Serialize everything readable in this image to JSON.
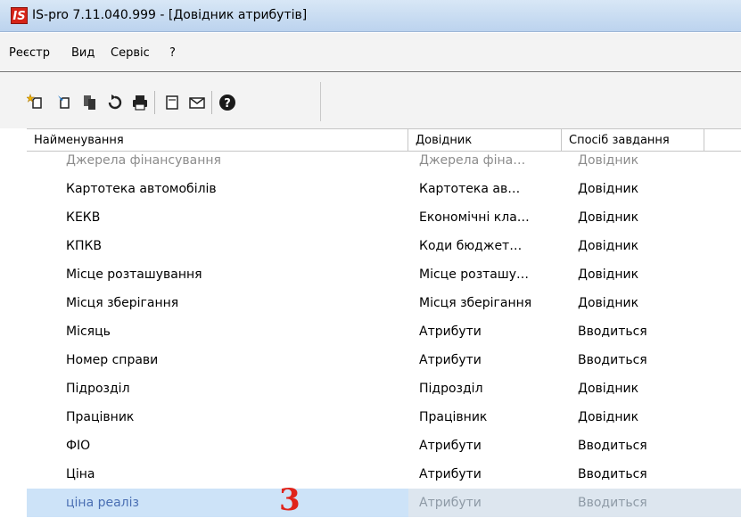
{
  "window": {
    "logo_text": "IS",
    "title": "IS-pro 7.11.040.999 - [Довідник атрибутів]"
  },
  "menu": {
    "items": [
      "Реєстр",
      "Вид",
      "Сервіс",
      "?"
    ]
  },
  "toolbar": {
    "buttons": [
      "new-doc-icon",
      "edit-doc-icon",
      "copy-doc-icon",
      "refresh-icon",
      "print-icon",
      "form-icon",
      "mail-icon",
      "help-icon"
    ]
  },
  "table": {
    "columns": [
      "Найменування",
      "Довідник",
      "Спосіб завдання"
    ],
    "rows": [
      [
        "Джерела фінансування",
        "Джерела фіна…",
        "Довідник"
      ],
      [
        "Картотека автомобілів",
        "Картотека ав…",
        "Довідник"
      ],
      [
        "КЕКВ",
        "Економічні кла…",
        "Довідник"
      ],
      [
        "КПКВ",
        "Коди бюджет…",
        "Довідник"
      ],
      [
        "Місце розташування",
        "Місце розташу…",
        "Довідник"
      ],
      [
        "Місця зберігання",
        "Місця зберігання",
        "Довідник"
      ],
      [
        "Місяць",
        "Атрибути",
        "Вводиться"
      ],
      [
        "Номер справи",
        "Атрибути",
        "Вводиться"
      ],
      [
        "Підрозділ",
        "Підрозділ",
        "Довідник"
      ],
      [
        "Працівник",
        "Працівник",
        "Довідник"
      ],
      [
        "ФІО",
        "Атрибути",
        "Вводиться"
      ],
      [
        "Ціна",
        "Атрибути",
        "Вводиться"
      ],
      [
        "ціна реаліз",
        "Атрибути",
        "Вводиться"
      ]
    ]
  },
  "annotation": {
    "label": "3"
  }
}
